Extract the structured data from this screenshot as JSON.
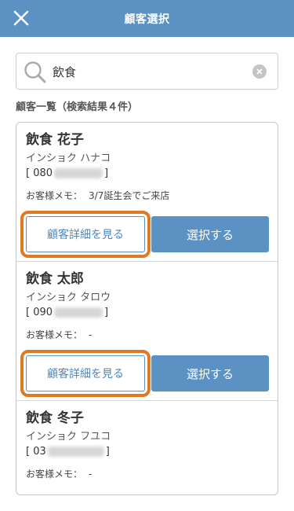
{
  "header": {
    "title": "顧客選択",
    "close_icon": "close-icon",
    "background": "#5b92c3"
  },
  "search": {
    "value": "飲食",
    "icon": "search-icon",
    "clear_icon": "clear-icon"
  },
  "list": {
    "heading": "顧客一覧（検索結果４件）",
    "memo_label": "お客様メモ：",
    "detail_button_label": "顧客詳細を見る",
    "select_button_label": "選択する",
    "highlight_color": "#e07a22",
    "customers": [
      {
        "name": "飲食 花子",
        "kana": "インショク ハナコ",
        "phone_prefix": "[ 080",
        "phone_suffix": "]",
        "memo": "3/7誕生会でご来店"
      },
      {
        "name": "飲食 太郎",
        "kana": "インショク タロウ",
        "phone_prefix": "[ 090",
        "phone_suffix": "]",
        "memo": "-"
      },
      {
        "name": "飲食 冬子",
        "kana": "インショク フユコ",
        "phone_prefix": "[ 03",
        "phone_suffix": "]",
        "memo": "-"
      }
    ]
  }
}
